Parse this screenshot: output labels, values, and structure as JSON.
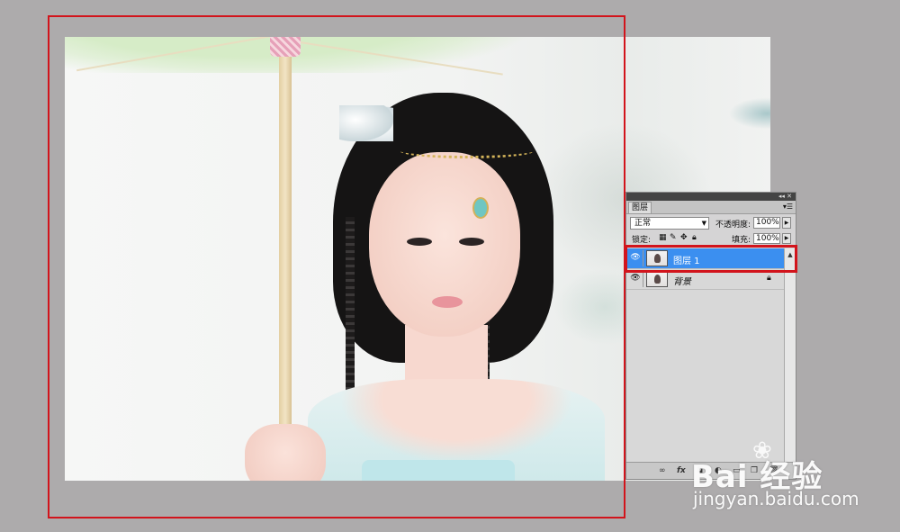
{
  "photo": {
    "description_icon": "portrait-photo"
  },
  "layers_panel": {
    "collapse_label": "◂◂ ✕",
    "tab_label": "图层",
    "menu_icon": "panel-menu-icon",
    "blend_mode": "正常",
    "opacity_label": "不透明度:",
    "opacity_value": "100%",
    "lock_label": "锁定:",
    "fill_label": "填充:",
    "fill_value": "100%",
    "layers": [
      {
        "name": "图层 1",
        "selected": true,
        "visible": true,
        "locked": false
      },
      {
        "name": "背景",
        "selected": false,
        "visible": true,
        "locked": true
      }
    ],
    "bottom_icons": [
      "link-icon",
      "fx-icon",
      "mask-icon",
      "adjustment-icon",
      "group-icon",
      "new-layer-icon",
      "trash-icon"
    ]
  },
  "annotations": {
    "selection_color": "#d2141c"
  },
  "watermark": {
    "brand": "Bai 经验",
    "url": "jingyan.baidu.com"
  }
}
